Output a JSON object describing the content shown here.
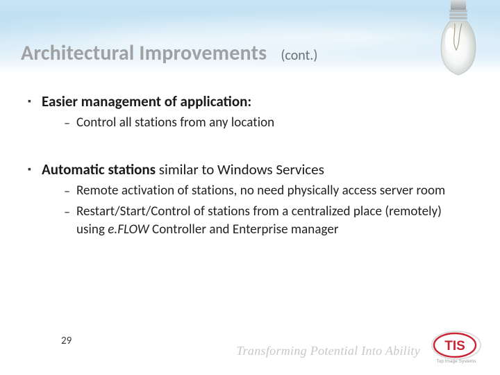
{
  "title": {
    "main": "Architectural Improvements",
    "cont": "(cont.)"
  },
  "bullets": [
    {
      "bold": "Easier management of application:",
      "regular": "",
      "subs": [
        "Control all stations from any location"
      ]
    },
    {
      "bold": "Automatic stations",
      "regular": " similar to Windows Services",
      "subs": [
        "Remote activation of stations, no need physically access server room",
        "Restart/Start/Control of stations from a centralized place (remotely) using <em>e.FLOW</em> Controller and Enterprise manager"
      ]
    }
  ],
  "page_number": "29",
  "tagline": "Transforming Potential Into Ability",
  "logo": {
    "text": "TIS",
    "subtext": "Top Image Systems",
    "color": "#c92434"
  },
  "bulb_icon": "lightbulb-icon"
}
